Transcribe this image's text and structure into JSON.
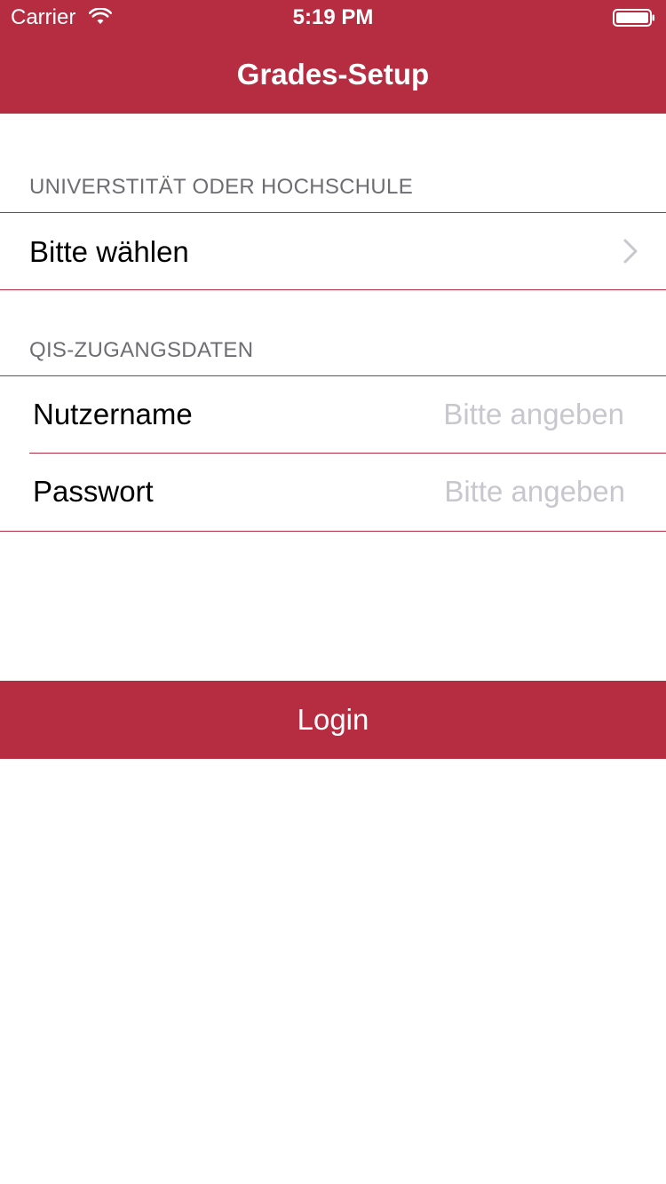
{
  "status_bar": {
    "carrier": "Carrier",
    "time": "5:19 PM",
    "icons": [
      "wifi-icon",
      "battery-icon"
    ]
  },
  "nav": {
    "title": "Grades-Setup"
  },
  "sections": {
    "institution": {
      "header": "UNIVERSTITÄT ODER HOCHSCHULE",
      "select_label": "Bitte wählen",
      "icon": "chevron-right-icon"
    },
    "credentials": {
      "header": "QIS-ZUGANGSDATEN",
      "username_label": "Nutzername",
      "username_placeholder": "Bitte angeben",
      "password_label": "Passwort",
      "password_placeholder": "Bitte angeben"
    }
  },
  "login_button": {
    "label": "Login"
  },
  "colors": {
    "accent": "#b62d42",
    "placeholder": "#c7c7cd",
    "section_header": "#6d6d72",
    "background": "#ffffff"
  }
}
